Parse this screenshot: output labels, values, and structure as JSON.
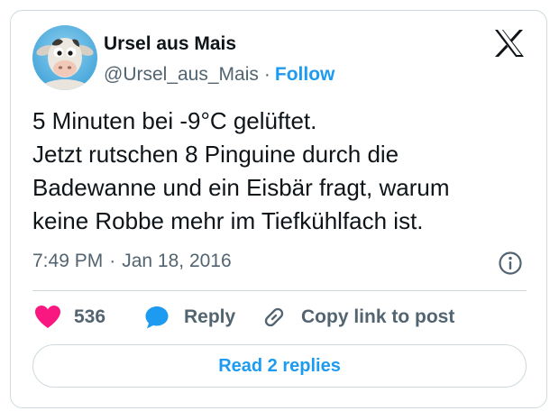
{
  "author": {
    "display_name": "Ursel aus Mais",
    "handle": "@Ursel_aus_Mais",
    "separator": "·",
    "follow_label": "Follow",
    "avatar_icon": "cow-cartoon-avatar"
  },
  "brand": {
    "logo_icon": "x-logo-icon"
  },
  "tweet": {
    "lines": [
      "5 Minuten bei -9°C gelüftet.",
      "Jetzt rutschen 8 Pinguine durch die",
      "Badewanne und ein Eisbär fragt, warum",
      "keine Robbe mehr im Tiefkühlfach ist."
    ]
  },
  "meta": {
    "time": "7:49 PM",
    "separator": "·",
    "date": "Jan 18, 2016",
    "info_icon": "info-icon"
  },
  "actions": {
    "like_count": "536",
    "reply_label": "Reply",
    "copy_label": "Copy link to post"
  },
  "footer": {
    "read_replies_label": "Read 2 replies"
  },
  "colors": {
    "accent": "#1d9bf0",
    "like": "#f91880",
    "text": "#0f1419",
    "muted": "#536471",
    "border": "#cfd9de"
  }
}
